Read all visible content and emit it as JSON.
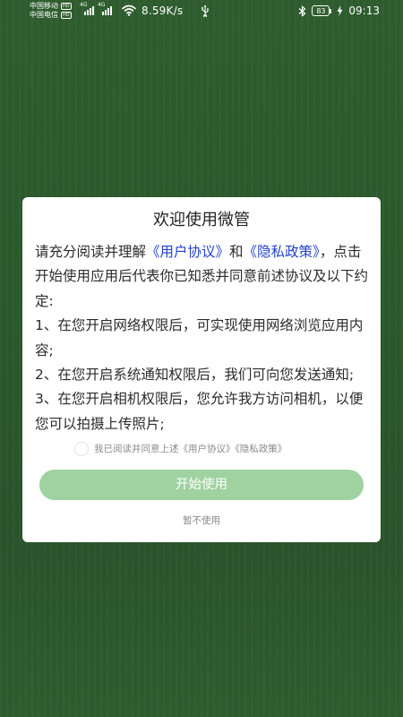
{
  "status_bar": {
    "carrier_1": "中国移动",
    "carrier_2": "中国电信",
    "hd_badge": "HD",
    "network_1": "4G",
    "network_2": "4G",
    "network_speed": "8.59K/s",
    "battery_level": "83",
    "time": "09:13",
    "icons": [
      "signal-icon",
      "wifi-icon",
      "usb-icon",
      "bluetooth-icon",
      "mute-icon",
      "battery-icon",
      "charging-icon"
    ]
  },
  "dialog": {
    "title": "欢迎使用微管",
    "intro_prefix": "请充分阅读并理解",
    "user_agreement_link": "《用户协议》",
    "and_text": "和",
    "privacy_policy_link": "《隐私政策》",
    "intro_suffix": "，点击开始使用应用后代表你已知悉并同意前述协议及以下约定:",
    "items": [
      "1、在您开启网络权限后，可实现使用网络浏览应用内容;",
      "2、在您开启系统通知权限后，我们可向您发送通知;",
      "3、在您开启相机权限后，您允许我方访问相机，以便您可以拍摄上传照片;"
    ],
    "agree_text": "我已阅读并同意上述",
    "agree_user_agreement": "《用户协议》",
    "agree_privacy_policy": "《隐私政策》",
    "agree_checked": false,
    "start_button": "开始使用",
    "decline_link": "暂不使用"
  },
  "colors": {
    "background": "#2c5a2d",
    "link": "#2442c9",
    "button": "#9fd2a0",
    "muted_text": "#8a8a8a"
  }
}
